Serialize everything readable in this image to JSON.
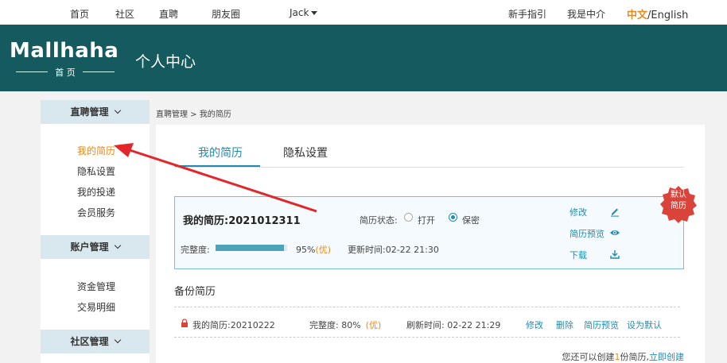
{
  "topnav": {
    "items": [
      "首页",
      "社区",
      "直聘",
      "朋友圈"
    ],
    "user": "Jack",
    "guide": "新手指引",
    "role": "我是中介",
    "lang_cn": "中文",
    "lang_en": "/English"
  },
  "header": {
    "logo": "Mallhaha",
    "logo_sub": "首 页",
    "title": "个人中心"
  },
  "sidebar": {
    "groups": [
      {
        "label": "直聘管理",
        "items": [
          "我的简历",
          "隐私设置",
          "我的投递",
          "会员服务"
        ]
      },
      {
        "label": "账户管理",
        "items": [
          "资金管理",
          "交易明细"
        ]
      },
      {
        "label": "社区管理",
        "items": []
      }
    ],
    "active_item": "我的简历"
  },
  "breadcrumb": "直聘管理 > 我的简历",
  "tabs": [
    "我的简历",
    "隐私设置"
  ],
  "resume": {
    "title": "我的简历:2021012311",
    "status_label": "简历状态:",
    "status_open": "打开",
    "status_private": "保密",
    "completeness_label": "完整度:",
    "completeness_pct": "95%",
    "completeness_value": 0.95,
    "grade": "(优)",
    "update_time": "更新时间:02-22  21:30",
    "actions": {
      "edit": "修改",
      "preview": "简历预览",
      "download": "下载"
    },
    "badge": "默认\n简历"
  },
  "backup": {
    "title": "备份简历",
    "row": {
      "name": "我的简历:20210222",
      "completeness": "完整度:  80%",
      "grade": "(优)",
      "refresh": "刷新时间:  02-22 21:29",
      "actions": [
        "修改",
        "删除",
        "简历预览",
        "设为默认"
      ]
    },
    "note_prefix": "您还可以创建",
    "note_num": "1",
    "note_suffix": "份简历,",
    "note_link": "立即创建"
  },
  "colors": {
    "header_bg": "#145a5e",
    "accent_blue": "#1f8cb0",
    "accent_orange": "#e98a1d",
    "badge_red": "#d9433a"
  }
}
